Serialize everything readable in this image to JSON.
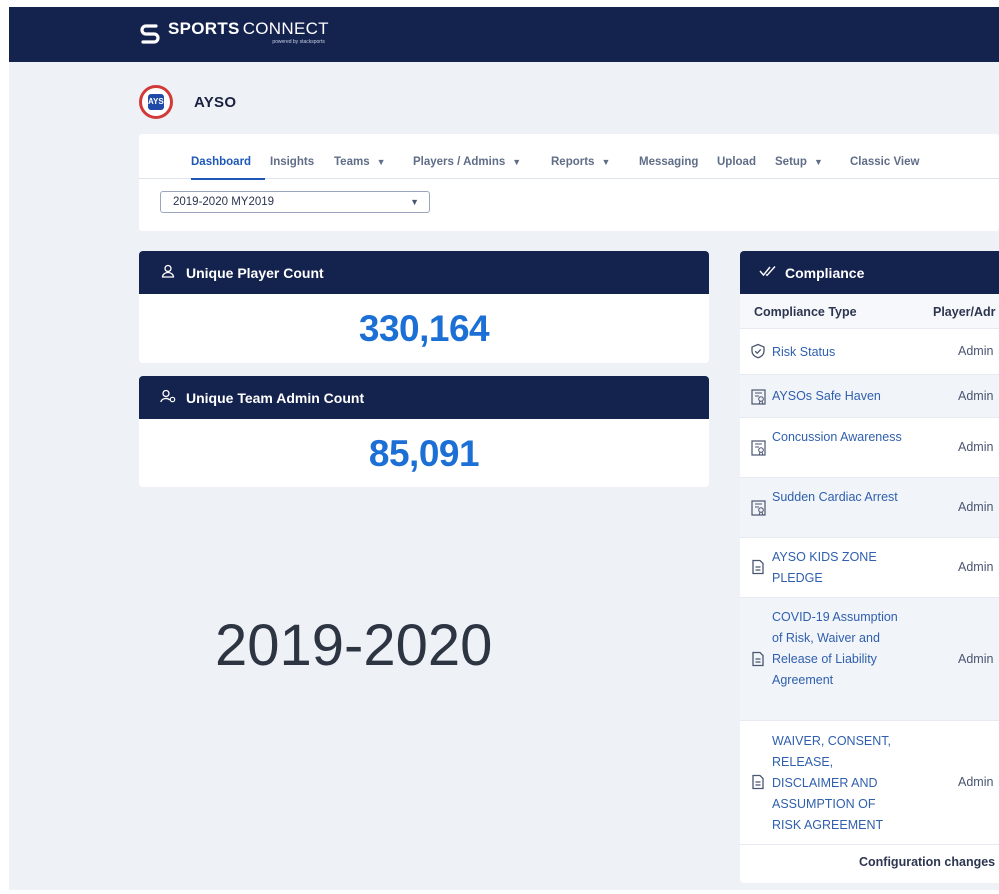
{
  "brand": {
    "name_bold": "SPORTS",
    "name_light": "CONNECT",
    "tagline": "powered by stacksports"
  },
  "org": {
    "name": "AYSO",
    "badge_text": "AYSO"
  },
  "nav": {
    "items": [
      {
        "label": "Dashboard",
        "caret": false,
        "active": true
      },
      {
        "label": "Insights",
        "caret": false
      },
      {
        "label": "Teams",
        "caret": true
      },
      {
        "label": "Players / Admins",
        "caret": true
      },
      {
        "label": "Reports",
        "caret": true
      },
      {
        "label": "Messaging",
        "caret": false
      },
      {
        "label": "Upload",
        "caret": false
      },
      {
        "label": "Setup",
        "caret": true
      },
      {
        "label": "Classic View",
        "caret": false
      }
    ]
  },
  "season_select": {
    "value": "2019-2020 MY2019"
  },
  "player_card": {
    "title": "Unique Player Count",
    "value": "330,164"
  },
  "admin_card": {
    "title": "Unique Team Admin Count",
    "value": "85,091"
  },
  "watermark": "2019-2020",
  "compliance": {
    "title": "Compliance",
    "col_type": "Compliance Type",
    "col_pa": "Player/Adr",
    "rows": [
      {
        "name": "Risk Status",
        "pa": "Admin",
        "icon": "shield-check-icon"
      },
      {
        "name": "AYSOs Safe Haven",
        "pa": "Admin",
        "icon": "training-certificate-icon"
      },
      {
        "name": "Concussion Awareness",
        "pa": "Admin",
        "icon": "training-certificate-icon"
      },
      {
        "name": "Sudden Cardiac Arrest",
        "pa": "Admin",
        "icon": "training-certificate-icon"
      },
      {
        "name": "AYSO KIDS ZONE PLEDGE",
        "pa": "Admin",
        "icon": "document-icon"
      },
      {
        "name": "COVID-19 Assumption of Risk, Waiver and Release of Liability Agreement",
        "pa": "Admin",
        "icon": "document-icon"
      },
      {
        "name": "WAIVER, CONSENT, RELEASE, DISCLAIMER AND ASSUMPTION OF RISK AGREEMENT",
        "pa": "Admin",
        "icon": "document-icon"
      }
    ],
    "footer": "Configuration changes"
  },
  "colors": {
    "navy": "#14224e",
    "accent_blue": "#1c6fd4",
    "link_blue": "#2f5fae"
  }
}
